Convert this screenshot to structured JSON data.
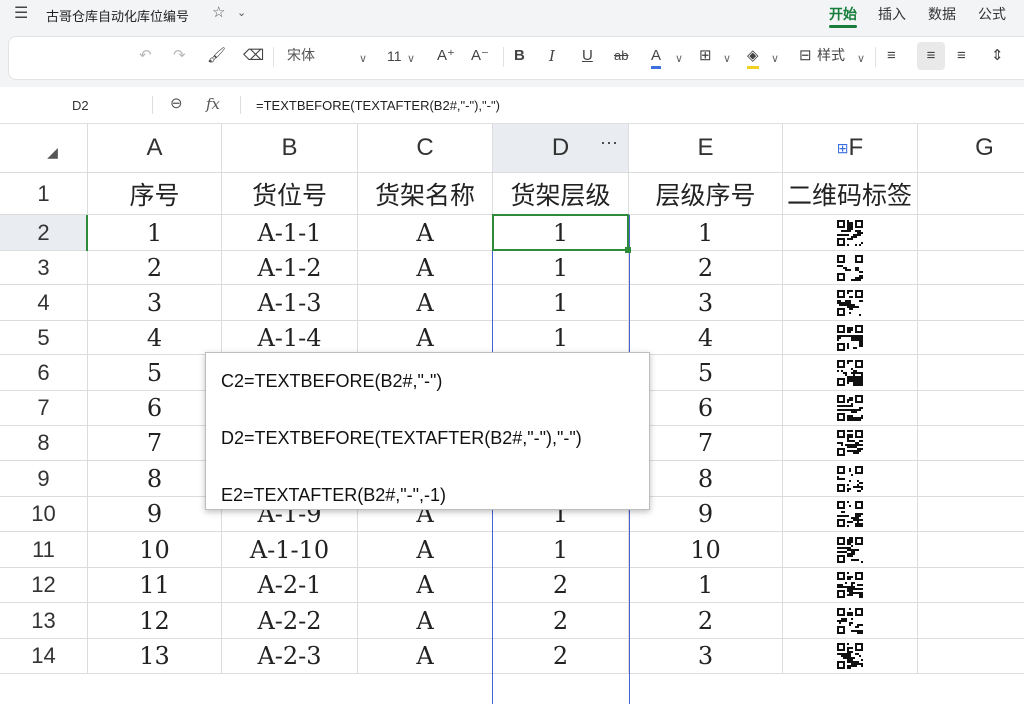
{
  "menubar": {
    "doc_title": "古哥仓库自动化库位编号",
    "tabs": [
      "开始",
      "插入",
      "数据",
      "公式"
    ],
    "active_tab": "开始"
  },
  "toolbar": {
    "font_name": "宋体",
    "font_size": "11",
    "style_label": "样式"
  },
  "formula_bar": {
    "name_box": "D2",
    "formula": "=TEXTBEFORE(TEXTAFTER(B2#,\"-\"),\"-\")"
  },
  "sheet": {
    "columns": [
      "A",
      "B",
      "C",
      "D",
      "E",
      "F",
      "G"
    ],
    "header_row": [
      "序号",
      "货位号",
      "货架名称",
      "货架层级",
      "层级序号",
      "二维码标签"
    ],
    "rows": [
      {
        "n": "2",
        "a": "1",
        "b": "A-1-1",
        "c": "A",
        "d": "1",
        "e": "1"
      },
      {
        "n": "3",
        "a": "2",
        "b": "A-1-2",
        "c": "A",
        "d": "1",
        "e": "2"
      },
      {
        "n": "4",
        "a": "3",
        "b": "A-1-3",
        "c": "A",
        "d": "1",
        "e": "3"
      },
      {
        "n": "5",
        "a": "4",
        "b": "A-1-4",
        "c": "A",
        "d": "1",
        "e": "4"
      },
      {
        "n": "6",
        "a": "5",
        "b": "",
        "c": "",
        "d": "",
        "e": "5"
      },
      {
        "n": "7",
        "a": "6",
        "b": "",
        "c": "",
        "d": "",
        "e": "6"
      },
      {
        "n": "8",
        "a": "7",
        "b": "",
        "c": "",
        "d": "",
        "e": "7"
      },
      {
        "n": "9",
        "a": "8",
        "b": "",
        "c": "",
        "d": "",
        "e": "8"
      },
      {
        "n": "10",
        "a": "9",
        "b": "A-1-9",
        "c": "A",
        "d": "1",
        "e": "9"
      },
      {
        "n": "11",
        "a": "10",
        "b": "A-1-10",
        "c": "A",
        "d": "1",
        "e": "10"
      },
      {
        "n": "12",
        "a": "11",
        "b": "A-2-1",
        "c": "A",
        "d": "2",
        "e": "1"
      },
      {
        "n": "13",
        "a": "12",
        "b": "A-2-2",
        "c": "A",
        "d": "2",
        "e": "2"
      },
      {
        "n": "14",
        "a": "13",
        "b": "A-2-3",
        "c": "A",
        "d": "2",
        "e": "3"
      }
    ]
  },
  "popup": {
    "line1": "C2=TEXTBEFORE(B2#,\"-\")",
    "line2": "D2=TEXTBEFORE(TEXTAFTER(B2#,\"-\"),\"-\")",
    "line3": "E2=TEXTAFTER(B2#,\"-\",-1)"
  },
  "colors": {
    "accent_green": "#167d3a",
    "selection_blue": "#4a62d8"
  }
}
